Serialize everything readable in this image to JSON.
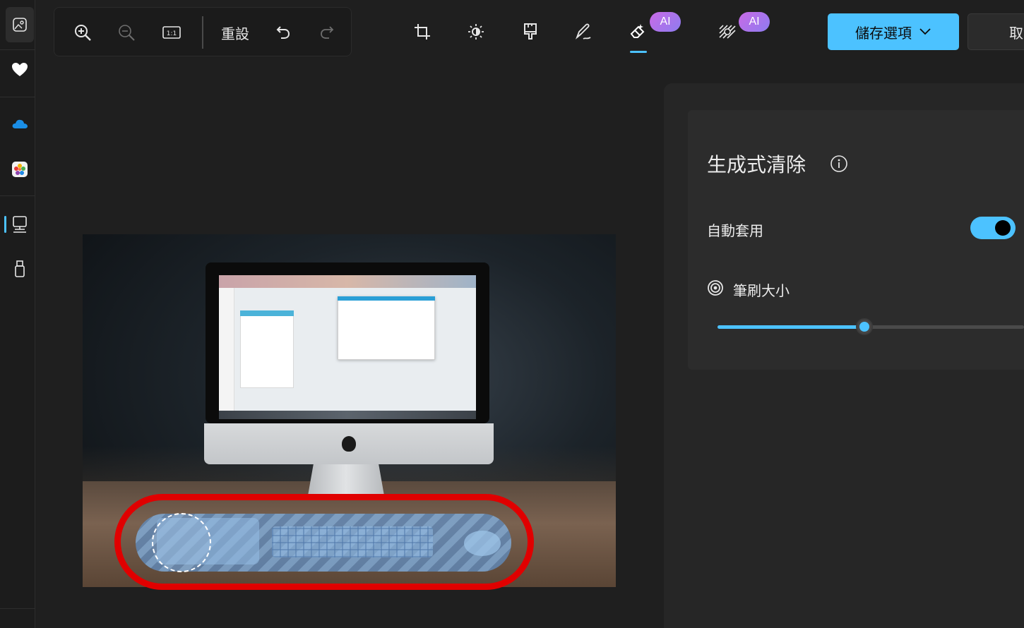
{
  "toolbar": {
    "reset_label": "重設",
    "ai_badge_label": "AI",
    "save_label": "儲存選項",
    "cancel_label": "取消"
  },
  "erase_panel": {
    "title": "生成式清除",
    "auto_apply_label": "自動套用",
    "auto_apply_on": true,
    "brush_size_label": "筆刷大小",
    "brush_size_fraction": 0.48
  },
  "icons": {
    "rail": [
      "gallery-icon",
      "favorites-heart-icon",
      "onedrive-cloud-icon",
      "photos-app-icon",
      "computer-icon",
      "usb-drive-icon"
    ],
    "edit_tools": [
      "crop-icon",
      "adjust-brightness-icon",
      "filter-brush-icon",
      "markup-pen-icon",
      "erase-icon",
      "background-icon"
    ]
  },
  "colors": {
    "accent": "#4cc2ff",
    "highlight": "#e00000",
    "ai_badge": "#a77aeb"
  }
}
